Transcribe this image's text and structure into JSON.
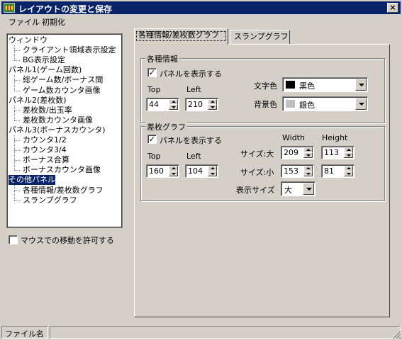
{
  "window": {
    "title": "レイアウトの変更と保存",
    "close_label": "×"
  },
  "menu": [
    "ファイル",
    "初期化"
  ],
  "tree": {
    "items": [
      {
        "label": "ウィンドウ",
        "level": 0
      },
      {
        "label": "クライアント領域表示設定",
        "level": 1
      },
      {
        "label": "BG表示設定",
        "level": 1
      },
      {
        "label": "パネル1(ゲーム回数)",
        "level": 0
      },
      {
        "label": "総ゲーム数/ボーナス間",
        "level": 1
      },
      {
        "label": "ゲーム数カウンタ画像",
        "level": 1
      },
      {
        "label": "パネル2(差枚数)",
        "level": 0
      },
      {
        "label": "差枚数/出玉率",
        "level": 1
      },
      {
        "label": "差枚数カウンタ画像",
        "level": 1
      },
      {
        "label": "パネル3(ボーナスカウンタ)",
        "level": 0
      },
      {
        "label": "カウンタ1/2",
        "level": 1
      },
      {
        "label": "カウンタ3/4",
        "level": 1
      },
      {
        "label": "ボーナス合算",
        "level": 1
      },
      {
        "label": "ボーナスカウンタ画像",
        "level": 1
      },
      {
        "label": "その他パネル",
        "level": 0,
        "selected": true
      },
      {
        "label": "各種情報/差枚数グラフ",
        "level": 1
      },
      {
        "label": "スランプグラフ",
        "level": 1
      }
    ]
  },
  "mouse_move": {
    "label": "マウスでの移動を許可する",
    "checked": false
  },
  "tabs": [
    {
      "label": "各種情報/差枚数グラフ",
      "active": true
    },
    {
      "label": "スランプグラフ",
      "active": false
    }
  ],
  "info_group": {
    "title": "各種情報",
    "show_panel": {
      "label": "パネルを表示する",
      "checked": true
    },
    "top_label": "Top",
    "left_label": "Left",
    "top_value": "44",
    "left_value": "210",
    "text_color_label": "文字色",
    "text_color": {
      "name": "黒色",
      "hex": "#000000"
    },
    "bg_color_label": "背景色",
    "bg_color": {
      "name": "銀色",
      "hex": "#c0c0c0"
    }
  },
  "graph_group": {
    "title": "差枚グラフ",
    "show_panel": {
      "label": "パネルを表示する",
      "checked": true
    },
    "top_label": "Top",
    "left_label": "Left",
    "top_value": "160",
    "left_value": "104",
    "width_label": "Width",
    "height_label": "Height",
    "size_large_label": "サイズ:大",
    "size_large_width": "209",
    "size_large_height": "113",
    "size_small_label": "サイズ:小",
    "size_small_width": "153",
    "size_small_height": "81",
    "display_size_label": "表示サイズ",
    "display_size_value": "大"
  },
  "status": {
    "file_label": "ファイル名",
    "file_value": ""
  }
}
